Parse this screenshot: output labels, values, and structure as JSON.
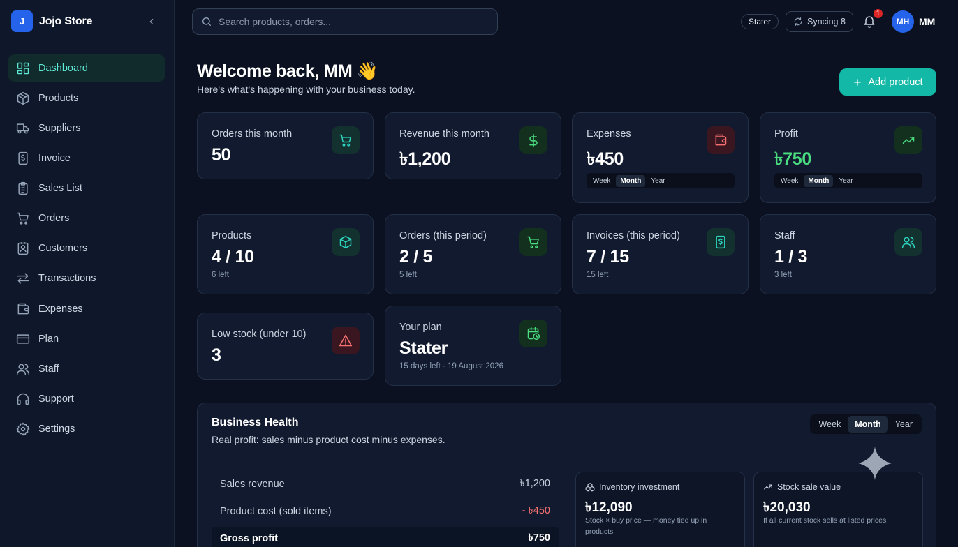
{
  "brand": {
    "logo": "J",
    "name": "Jojo Store"
  },
  "sidebar": {
    "items": [
      {
        "label": "Dashboard",
        "icon": "dashboard-icon",
        "active": true
      },
      {
        "label": "Products",
        "icon": "box-icon"
      },
      {
        "label": "Suppliers",
        "icon": "truck-icon"
      },
      {
        "label": "Invoice",
        "icon": "invoice-icon"
      },
      {
        "label": "Sales List",
        "icon": "clipboard-icon"
      },
      {
        "label": "Orders",
        "icon": "cart-icon"
      },
      {
        "label": "Customers",
        "icon": "contact-icon"
      },
      {
        "label": "Transactions",
        "icon": "arrows-icon"
      },
      {
        "label": "Expenses",
        "icon": "wallet-icon"
      },
      {
        "label": "Plan",
        "icon": "card-icon"
      },
      {
        "label": "Staff",
        "icon": "users-icon"
      },
      {
        "label": "Support",
        "icon": "headset-icon"
      },
      {
        "label": "Settings",
        "icon": "gear-icon"
      }
    ]
  },
  "topbar": {
    "search_placeholder": "Search products, orders...",
    "plan_pill": "Stater",
    "sync_label": "Syncing 8",
    "notification_count": "1",
    "avatar_initials": "MH",
    "user_name": "MM"
  },
  "header": {
    "welcome": "Welcome back, MM 👋",
    "subtitle": "Here's what's happening with your business today.",
    "add_button": "Add product"
  },
  "stats": {
    "orders_month": {
      "label": "Orders this month",
      "value": "50"
    },
    "revenue_month": {
      "label": "Revenue this month",
      "value": "৳1,200"
    },
    "expenses": {
      "label": "Expenses",
      "value": "৳450",
      "periods": [
        "Week",
        "Month",
        "Year"
      ],
      "selected": "Month"
    },
    "profit": {
      "label": "Profit",
      "value": "৳750",
      "periods": [
        "Week",
        "Month",
        "Year"
      ],
      "selected": "Month"
    },
    "products": {
      "label": "Products",
      "value": "4 / 10",
      "note": "6 left"
    },
    "orders_period": {
      "label": "Orders (this period)",
      "value": "2 / 5",
      "note": "5 left"
    },
    "invoices_period": {
      "label": "Invoices (this period)",
      "value": "7 / 15",
      "note": "15 left"
    },
    "staff": {
      "label": "Staff",
      "value": "1 / 3",
      "note": "3 left"
    },
    "low_stock": {
      "label": "Low stock (under 10)",
      "value": "3"
    },
    "plan": {
      "label": "Your plan",
      "value": "Stater",
      "note": "15 days left · 19 August 2026"
    }
  },
  "health": {
    "title": "Business Health",
    "subtitle": "Real profit: sales minus product cost minus expenses.",
    "periods": [
      "Week",
      "Month",
      "Year"
    ],
    "selected": "Month",
    "rows": [
      {
        "label": "Sales revenue",
        "amount": "৳1,200"
      },
      {
        "label": "Product cost (sold items)",
        "amount": "- ৳450"
      },
      {
        "label": "Gross profit",
        "amount": "৳750"
      }
    ],
    "inventory": {
      "title": "Inventory investment",
      "value": "৳12,090",
      "note": "Stock × buy price — money tied up in products"
    },
    "stock_value": {
      "title": "Stock sale value",
      "value": "৳20,030",
      "note": "If all current stock sells at listed prices"
    }
  },
  "colors": {
    "accent": "#14b8a6",
    "brand": "#2563eb",
    "positive": "#4ade80",
    "negative": "#f87171"
  }
}
